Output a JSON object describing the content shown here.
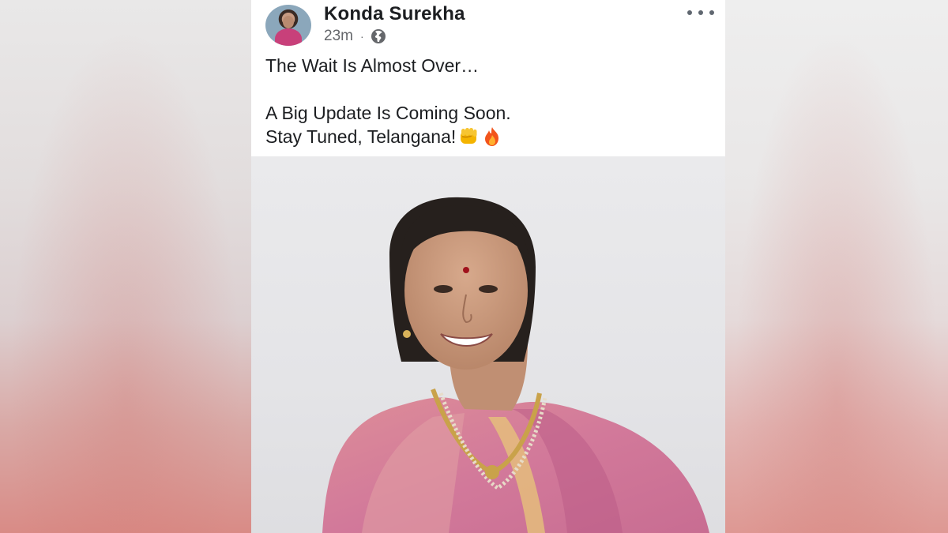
{
  "post": {
    "author": "Konda Surekha",
    "timestamp": "23m",
    "separator": "·",
    "privacy_icon": "globe-icon",
    "menu_icon": "more-icon",
    "lines": [
      "The Wait Is Almost Over…",
      "A Big Update Is Coming Soon.",
      "Stay Tuned, Telangana!"
    ],
    "emojis": [
      "raised-fist-emoji",
      "fire-emoji"
    ]
  },
  "colors": {
    "text_primary": "#1c1e21",
    "text_secondary": "#65676b",
    "saree": "#d8849c"
  }
}
